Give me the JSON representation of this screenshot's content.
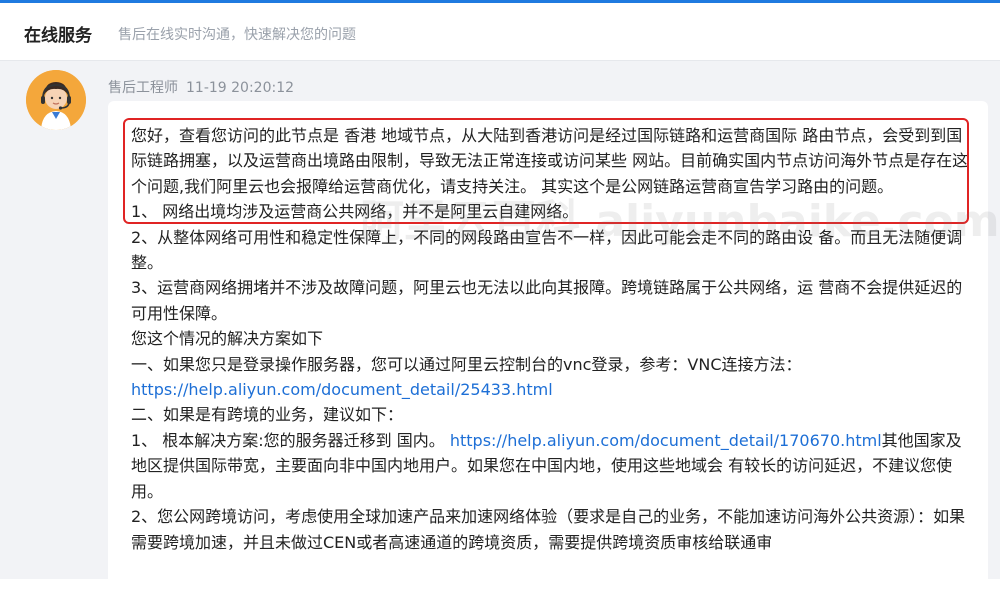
{
  "header": {
    "title": "在线服务",
    "subtitle": "售后在线实时沟通，快速解决您的问题"
  },
  "message": {
    "sender": "售后工程师",
    "time": "11-19 20:20:12",
    "highlighted_text": "您好，查看您访问的此节点是 香港 地域节点，从大陆到香港访问是经过国际链路和运营商国际 路由节点，会受到到国际链路拥塞，以及运营商出境路由限制，导致无法正常连接或访问某些 网站。目前确实国内节点访问海外节点是存在这个问题,我们阿里云也会报障给运营商优化，请支持关注。 其实这个是公网链路运营商宣告学习路由的问题。",
    "p1": "1、 网络出境均涉及运营商公共网络，并不是阿里云自建网络。",
    "p2": "2、从整体网络可用性和稳定性保障上，不同的网段路由宣告不一样，因此可能会走不同的路由设 备。而且无法随便调整。",
    "p3": "3、运营商网络拥堵并不涉及故障问题，阿里云也无法以此向其报障。跨境链路属于公共网络，运 营商不会提供延迟的可用性保障。",
    "p4": "您这个情况的解决方案如下",
    "p5_prefix": "一、如果您只是登录操作服务器，您可以通过阿里云控制台的vnc登录，参考：VNC连接方法：",
    "p5_link": "https://help.aliyun.com/document_detail/25433.html",
    "p6": "二、如果是有跨境的业务，建议如下：",
    "p7_prefix": "1、 根本解决方案:您的服务器迁移到 国内。 ",
    "p7_link": "https://help.aliyun.com/document_detail/170670.html",
    "p7_suffix": "其他国家及地区提供国际带宽，主要面向非中国内地用户。如果您在中国内地，使用这些地域会 有较长的访问延迟，不建议您使用。",
    "p8": "2、您公网跨境访问，考虑使用全球加速产品来加速网络体验（要求是自己的业务，不能加速访问海外公共资源）：如果需要跨境加速，并且未做过CEN或者高速通道的跨境资质，需要提供跨境资质审核给联通审"
  },
  "watermark": "阿里云百科 aliyunbaike.com",
  "colors": {
    "accent": "#1f7ae0",
    "highlight_border": "#e02424",
    "link": "#1d6fd6"
  }
}
